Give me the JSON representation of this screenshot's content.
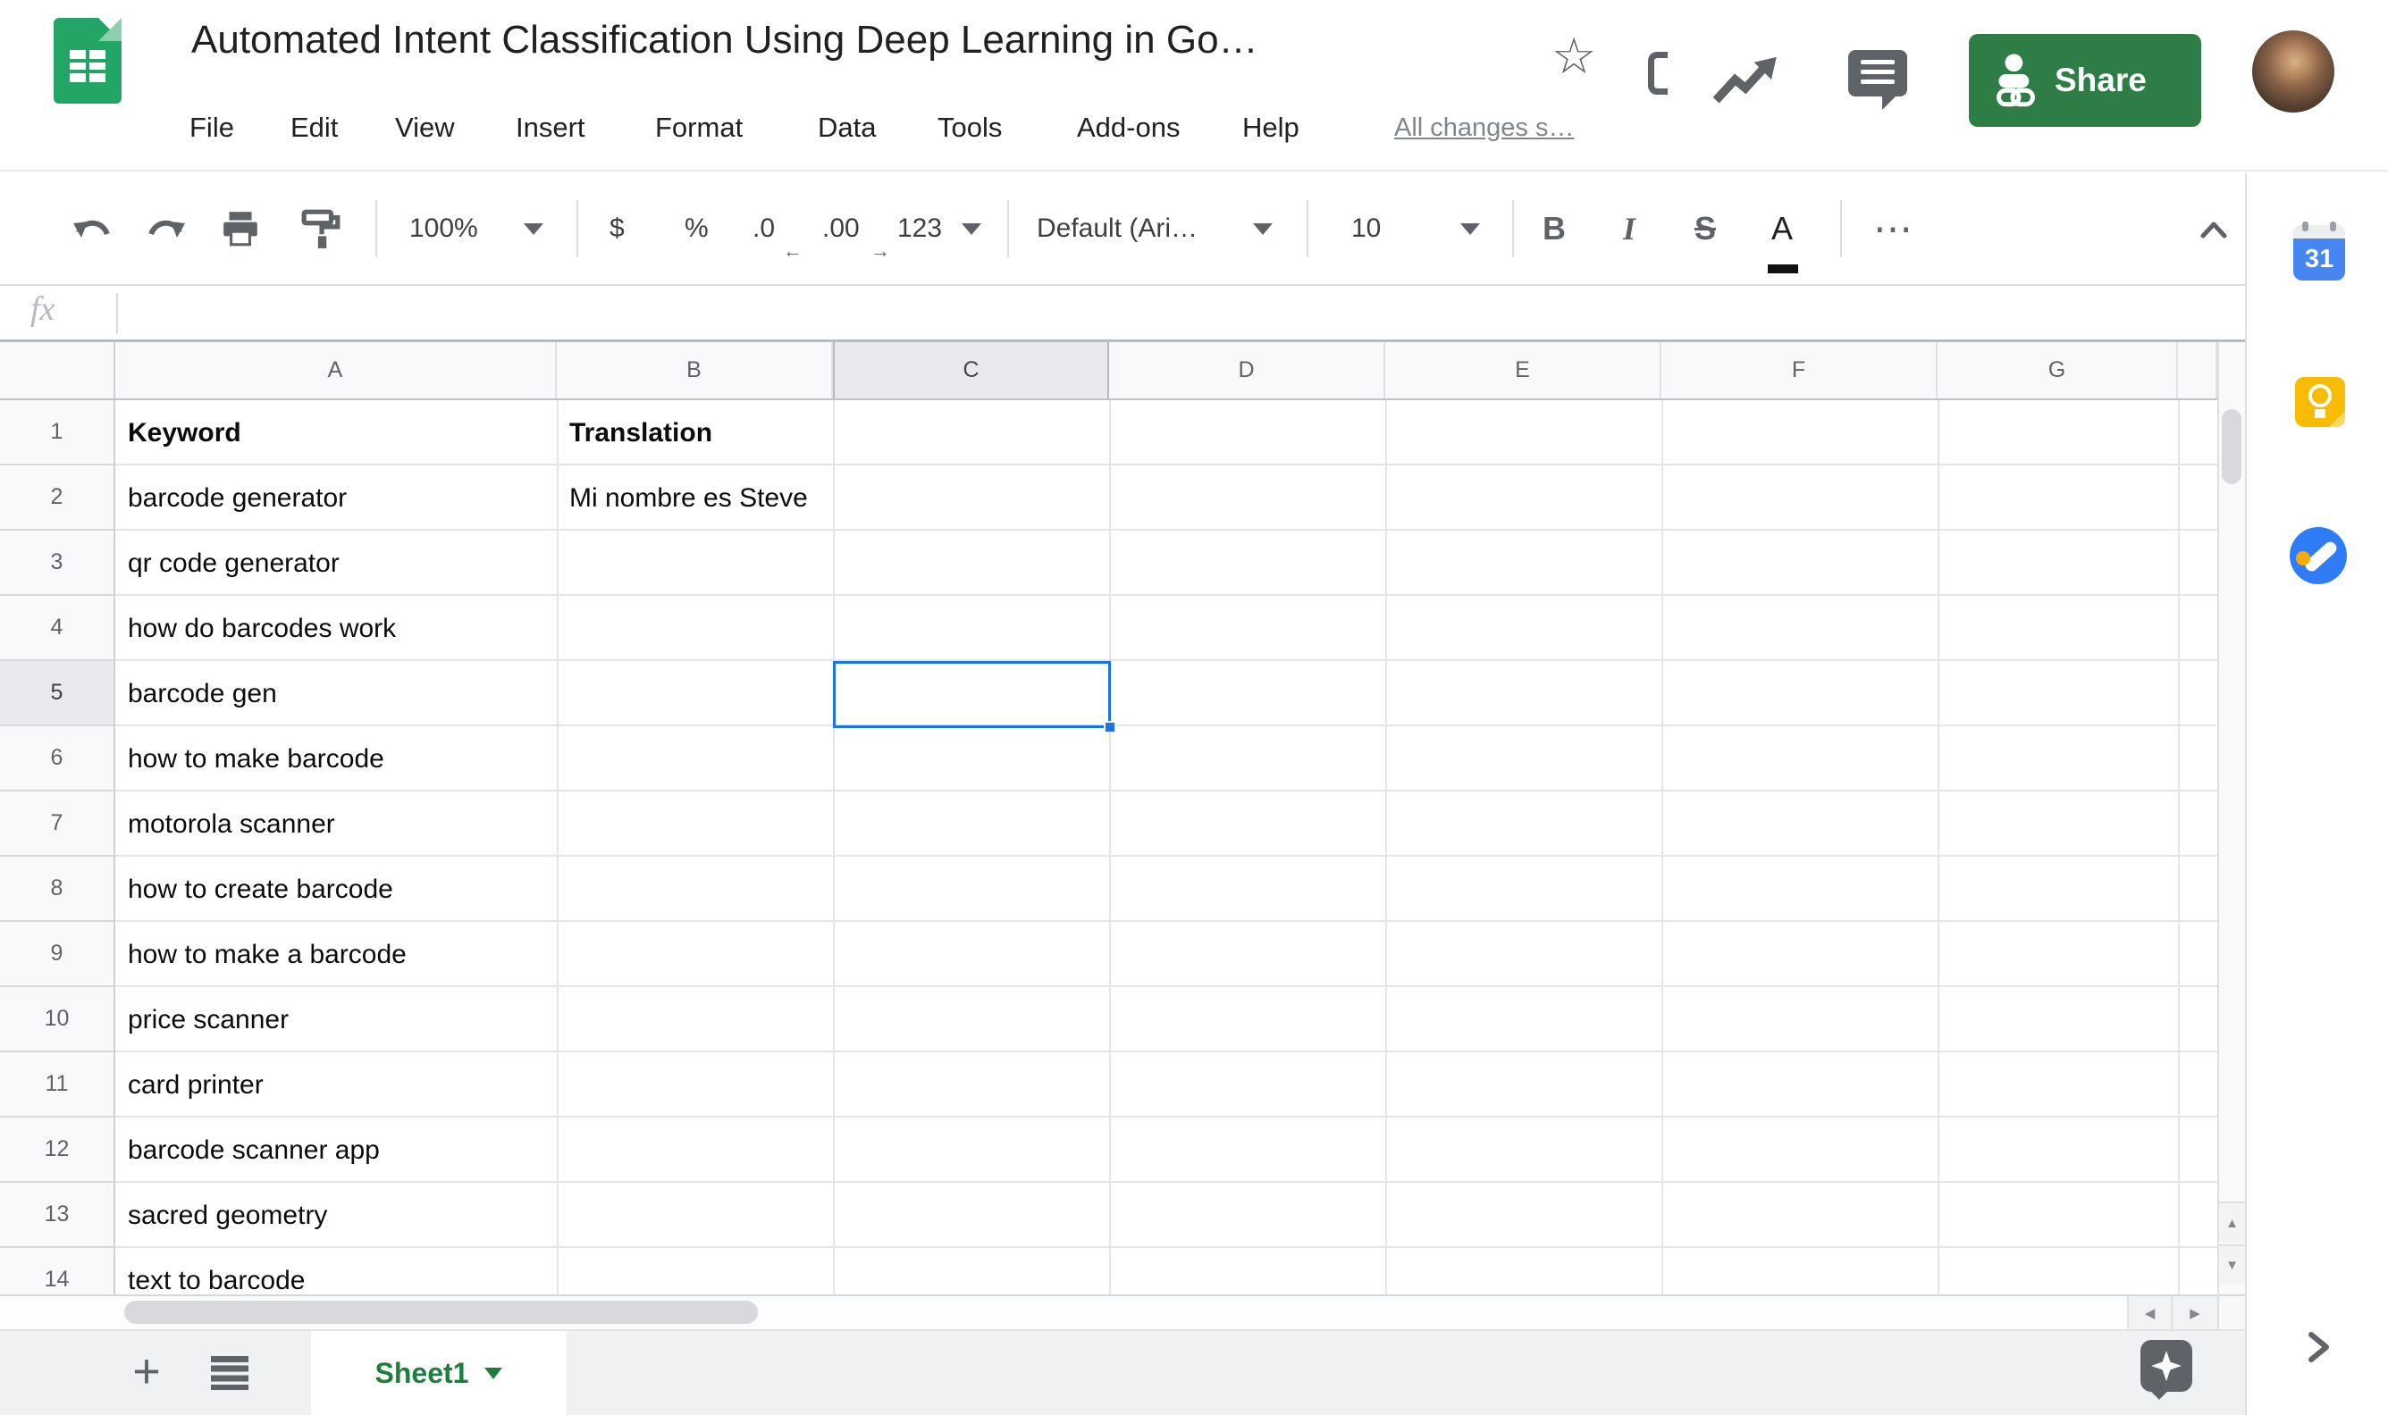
{
  "header": {
    "doc_title": "Automated Intent Classification Using Deep Learning in Go…",
    "menus": [
      "File",
      "Edit",
      "View",
      "Insert",
      "Format",
      "Data",
      "Tools",
      "Add-ons",
      "Help"
    ],
    "save_status": "All changes s…",
    "share_label": "Share"
  },
  "toolbar": {
    "zoom": "100%",
    "currency": "$",
    "percent": "%",
    "decrease_decimal": ".0",
    "increase_decimal": ".00",
    "more_formats": "123",
    "font_name": "Default (Ari…",
    "font_size": "10",
    "bold": "B",
    "italic": "I",
    "strikethrough": "S",
    "text_color": "A"
  },
  "formula_bar": {
    "fx_label": "fx",
    "value": ""
  },
  "grid": {
    "columns": [
      "A",
      "B",
      "C",
      "D",
      "E",
      "F",
      "G"
    ],
    "selected_column": "C",
    "selected_cell": "C5",
    "rows": [
      {
        "n": "1",
        "a": "Keyword",
        "b": "Translation"
      },
      {
        "n": "2",
        "a": "barcode generator",
        "b": "Mi nombre es Steve"
      },
      {
        "n": "3",
        "a": "qr code generator",
        "b": ""
      },
      {
        "n": "4",
        "a": "how do barcodes work",
        "b": ""
      },
      {
        "n": "5",
        "a": "barcode gen",
        "b": ""
      },
      {
        "n": "6",
        "a": "how to make barcode",
        "b": ""
      },
      {
        "n": "7",
        "a": "motorola scanner",
        "b": ""
      },
      {
        "n": "8",
        "a": "how to create barcode",
        "b": ""
      },
      {
        "n": "9",
        "a": "how to make a barcode",
        "b": ""
      },
      {
        "n": "10",
        "a": "price scanner",
        "b": ""
      },
      {
        "n": "11",
        "a": "card printer",
        "b": ""
      },
      {
        "n": "12",
        "a": "barcode scanner app",
        "b": ""
      },
      {
        "n": "13",
        "a": "sacred geometry",
        "b": ""
      },
      {
        "n": "14",
        "a": "text to barcode",
        "b": ""
      }
    ]
  },
  "sheet_bar": {
    "active_tab": "Sheet1"
  },
  "side_panel": {
    "calendar_label": "31"
  },
  "icons": {
    "star": "☆",
    "more": "⋯",
    "plus": "+",
    "up": "▲",
    "down": "▼",
    "left": "◀",
    "right": "▶",
    "dec_arrow": "←",
    "inc_arrow": "→"
  },
  "colors": {
    "selection_blue": "#1a73e8",
    "share_green": "#2e7d46",
    "sheet_tab_green": "#1e7e3e",
    "logo_green": "#23a566",
    "icon_gray": "#5f6368",
    "header_bg": "#f8f9fa",
    "selected_header_bg": "#e8eaed"
  }
}
